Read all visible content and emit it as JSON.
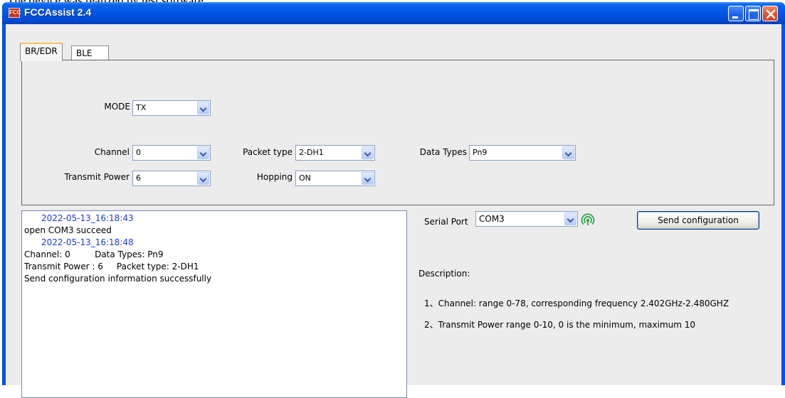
{
  "doc_caption": "The device was realized by test software.",
  "window": {
    "title": "FCCAssist 2.4",
    "app_icon_text": "FCC"
  },
  "tabs": [
    {
      "label": "BR/EDR",
      "selected": true
    },
    {
      "label": "BLE",
      "selected": false
    }
  ],
  "settings": {
    "mode": {
      "label": "MODE",
      "value": "TX"
    },
    "channel": {
      "label": "Channel",
      "value": "0"
    },
    "packet_type": {
      "label": "Packet type",
      "value": "2-DH1"
    },
    "data_types": {
      "label": "Data Types",
      "value": "Pn9"
    },
    "transmit_power": {
      "label": "Transmit Power",
      "value": "6"
    },
    "hopping": {
      "label": "Hopping",
      "value": "ON"
    }
  },
  "log": {
    "lines": [
      {
        "kind": "timestamp",
        "text": "2022-05-13_16:18:43"
      },
      {
        "kind": "text",
        "text": "open COM3 succeed"
      },
      {
        "kind": "timestamp",
        "text": "2022-05-13_16:18:48"
      },
      {
        "kind": "text",
        "text": "Channel: 0         Data Types: Pn9"
      },
      {
        "kind": "text",
        "text": "Transmit Power : 6     Packet type: 2-DH1"
      },
      {
        "kind": "text",
        "text": "Send configuration information successfully"
      }
    ]
  },
  "serial": {
    "label": "Serial Port",
    "value": "COM3",
    "status_icon": "signal-icon",
    "status_color": "#2fa84a"
  },
  "send_button": "Send configuration",
  "description": {
    "heading": "Description:",
    "items": [
      "1、Channel: range 0-78, corresponding frequency 2.402GHz-2.480GHZ",
      "2、Transmit Power  range 0-10, 0 is the minimum, maximum 10"
    ]
  },
  "colors": {
    "titlebar": "#0055e5",
    "timestamp": "#1f3be0",
    "window_bg": "#ececec"
  }
}
